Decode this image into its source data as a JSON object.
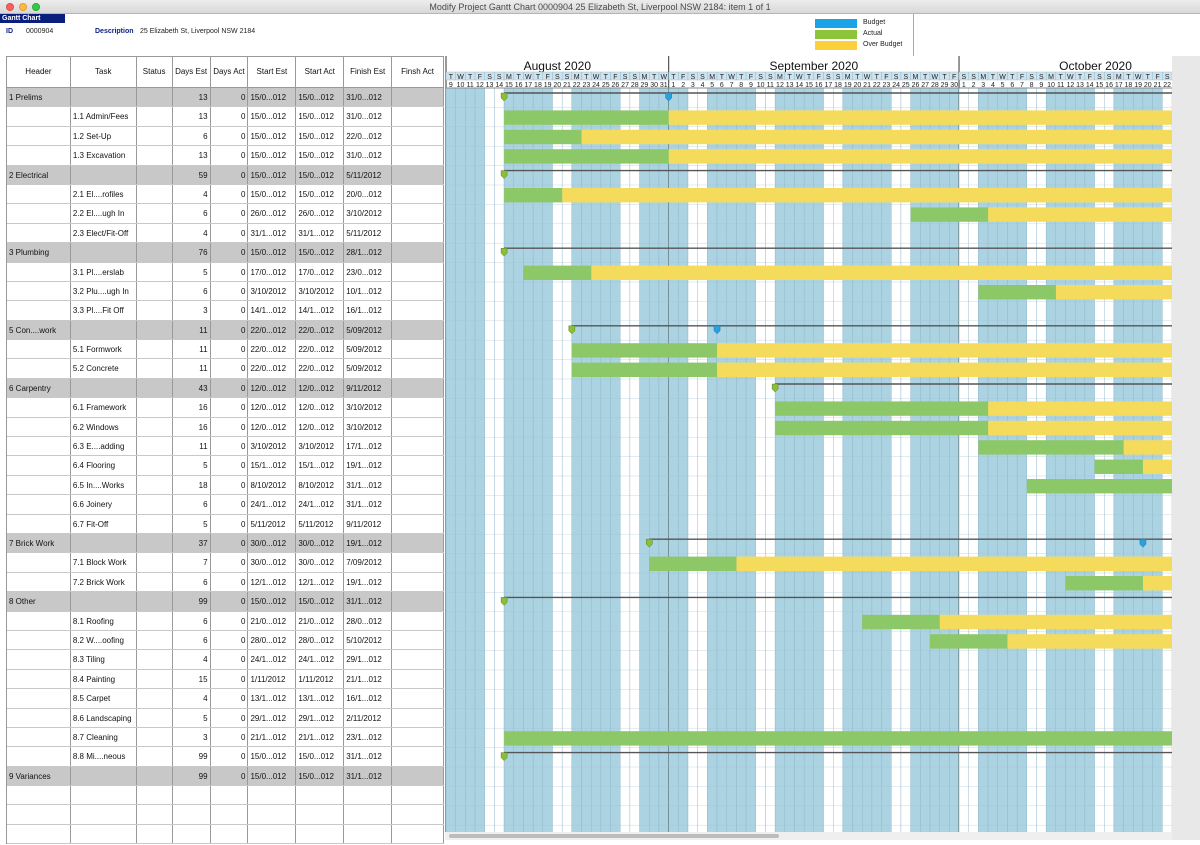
{
  "window": {
    "title": "Modify Project Gantt Chart 0000904 25 Elizabeth St, Liverpool NSW 2184: item 1  of  1"
  },
  "app_label": "Gantt Chart",
  "info": {
    "id_label": "ID",
    "id_value": "0000904",
    "desc_label": "Description",
    "desc_value": "25 Elizabeth St, Liverpool NSW 2184"
  },
  "legend": [
    {
      "label": "Budget",
      "color": "#1aa3e6"
    },
    {
      "label": "Actual",
      "color": "#8cc43a"
    },
    {
      "label": "Over Budget",
      "color": "#fbd03a"
    }
  ],
  "colors": {
    "weekday": "#acd3e2",
    "weekend": "#ffffff",
    "actual": "#8dc868",
    "over": "#f5db5c",
    "budget_marker": "#2aa0de",
    "actual_marker": "#8cbe3a",
    "group_row": "#c8c8c8"
  },
  "columns": [
    "Header",
    "Task",
    "Status",
    "Days Est",
    "Days Act",
    "Start Est",
    "Start Act",
    "Finish Est",
    "Finsh Act"
  ],
  "rows": [
    {
      "group": true,
      "header": "1 Prelims",
      "task": "",
      "days_est": "13",
      "days_act": "0",
      "start_est": "15/0...012",
      "start_act": "15/0...012",
      "finish_est": "31/0...012"
    },
    {
      "group": false,
      "header": "",
      "task": "1.1 Admin/Fees",
      "days_est": "13",
      "days_act": "0",
      "start_est": "15/0...012",
      "start_act": "15/0...012",
      "finish_est": "31/0...012"
    },
    {
      "group": false,
      "header": "",
      "task": "1.2 Set-Up",
      "days_est": "6",
      "days_act": "0",
      "start_est": "15/0...012",
      "start_act": "15/0...012",
      "finish_est": "22/0...012"
    },
    {
      "group": false,
      "header": "",
      "task": "1.3 Excavation",
      "days_est": "13",
      "days_act": "0",
      "start_est": "15/0...012",
      "start_act": "15/0...012",
      "finish_est": "31/0...012"
    },
    {
      "group": true,
      "header": "2 Electrical",
      "task": "",
      "days_est": "59",
      "days_act": "0",
      "start_est": "15/0...012",
      "start_act": "15/0...012",
      "finish_est": "5/11/2012"
    },
    {
      "group": false,
      "header": "",
      "task": "2.1 El....rofiles",
      "days_est": "4",
      "days_act": "0",
      "start_est": "15/0...012",
      "start_act": "15/0...012",
      "finish_est": "20/0...012"
    },
    {
      "group": false,
      "header": "",
      "task": "2.2 El....ugh In",
      "days_est": "6",
      "days_act": "0",
      "start_est": "26/0...012",
      "start_act": "26/0...012",
      "finish_est": "3/10/2012"
    },
    {
      "group": false,
      "header": "",
      "task": "2.3 Elect/Fit-Off",
      "days_est": "4",
      "days_act": "0",
      "start_est": "31/1...012",
      "start_act": "31/1...012",
      "finish_est": "5/11/2012"
    },
    {
      "group": true,
      "header": "3 Plumbing",
      "task": "",
      "days_est": "76",
      "days_act": "0",
      "start_est": "15/0...012",
      "start_act": "15/0...012",
      "finish_est": "28/1...012"
    },
    {
      "group": false,
      "header": "",
      "task": "3.1 Pl....erslab",
      "days_est": "5",
      "days_act": "0",
      "start_est": "17/0...012",
      "start_act": "17/0...012",
      "finish_est": "23/0...012"
    },
    {
      "group": false,
      "header": "",
      "task": "3.2 Plu....ugh In",
      "days_est": "6",
      "days_act": "0",
      "start_est": "3/10/2012",
      "start_act": "3/10/2012",
      "finish_est": "10/1...012"
    },
    {
      "group": false,
      "header": "",
      "task": "3.3 Pl....Fit Off",
      "days_est": "3",
      "days_act": "0",
      "start_est": "14/1...012",
      "start_act": "14/1...012",
      "finish_est": "16/1...012"
    },
    {
      "group": true,
      "header": "5 Con....work",
      "task": "",
      "days_est": "11",
      "days_act": "0",
      "start_est": "22/0...012",
      "start_act": "22/0...012",
      "finish_est": "5/09/2012"
    },
    {
      "group": false,
      "header": "",
      "task": "5.1 Formwork",
      "days_est": "11",
      "days_act": "0",
      "start_est": "22/0...012",
      "start_act": "22/0...012",
      "finish_est": "5/09/2012"
    },
    {
      "group": false,
      "header": "",
      "task": "5.2 Concrete",
      "days_est": "11",
      "days_act": "0",
      "start_est": "22/0...012",
      "start_act": "22/0...012",
      "finish_est": "5/09/2012"
    },
    {
      "group": true,
      "header": "6 Carpentry",
      "task": "",
      "days_est": "43",
      "days_act": "0",
      "start_est": "12/0...012",
      "start_act": "12/0...012",
      "finish_est": "9/11/2012"
    },
    {
      "group": false,
      "header": "",
      "task": "6.1 Framework",
      "days_est": "16",
      "days_act": "0",
      "start_est": "12/0...012",
      "start_act": "12/0...012",
      "finish_est": "3/10/2012"
    },
    {
      "group": false,
      "header": "",
      "task": "6.2 Windows",
      "days_est": "16",
      "days_act": "0",
      "start_est": "12/0...012",
      "start_act": "12/0...012",
      "finish_est": "3/10/2012"
    },
    {
      "group": false,
      "header": "",
      "task": "6.3 E....adding",
      "days_est": "11",
      "days_act": "0",
      "start_est": "3/10/2012",
      "start_act": "3/10/2012",
      "finish_est": "17/1...012"
    },
    {
      "group": false,
      "header": "",
      "task": "6.4 Flooring",
      "days_est": "5",
      "days_act": "0",
      "start_est": "15/1...012",
      "start_act": "15/1...012",
      "finish_est": "19/1...012"
    },
    {
      "group": false,
      "header": "",
      "task": "6.5 In....Works",
      "days_est": "18",
      "days_act": "0",
      "start_est": "8/10/2012",
      "start_act": "8/10/2012",
      "finish_est": "31/1...012"
    },
    {
      "group": false,
      "header": "",
      "task": "6.6 Joinery",
      "days_est": "6",
      "days_act": "0",
      "start_est": "24/1...012",
      "start_act": "24/1...012",
      "finish_est": "31/1...012"
    },
    {
      "group": false,
      "header": "",
      "task": "6.7 Fit-Off",
      "days_est": "5",
      "days_act": "0",
      "start_est": "5/11/2012",
      "start_act": "5/11/2012",
      "finish_est": "9/11/2012"
    },
    {
      "group": true,
      "header": "7 Brick Work",
      "task": "",
      "days_est": "37",
      "days_act": "0",
      "start_est": "30/0...012",
      "start_act": "30/0...012",
      "finish_est": "19/1...012"
    },
    {
      "group": false,
      "header": "",
      "task": "7.1 Block Work",
      "days_est": "7",
      "days_act": "0",
      "start_est": "30/0...012",
      "start_act": "30/0...012",
      "finish_est": "7/09/2012"
    },
    {
      "group": false,
      "header": "",
      "task": "7.2 Brick Work",
      "days_est": "6",
      "days_act": "0",
      "start_est": "12/1...012",
      "start_act": "12/1...012",
      "finish_est": "19/1...012"
    },
    {
      "group": true,
      "header": "8 Other",
      "task": "",
      "days_est": "99",
      "days_act": "0",
      "start_est": "15/0...012",
      "start_act": "15/0...012",
      "finish_est": "31/1...012"
    },
    {
      "group": false,
      "header": "",
      "task": "8.1 Roofing",
      "days_est": "6",
      "days_act": "0",
      "start_est": "21/0...012",
      "start_act": "21/0...012",
      "finish_est": "28/0...012"
    },
    {
      "group": false,
      "header": "",
      "task": "8.2 W....oofing",
      "days_est": "6",
      "days_act": "0",
      "start_est": "28/0...012",
      "start_act": "28/0...012",
      "finish_est": "5/10/2012"
    },
    {
      "group": false,
      "header": "",
      "task": "8.3 Tiling",
      "days_est": "4",
      "days_act": "0",
      "start_est": "24/1...012",
      "start_act": "24/1...012",
      "finish_est": "29/1...012"
    },
    {
      "group": false,
      "header": "",
      "task": "8.4 Painting",
      "days_est": "15",
      "days_act": "0",
      "start_est": "1/11/2012",
      "start_act": "1/11/2012",
      "finish_est": "21/1...012"
    },
    {
      "group": false,
      "header": "",
      "task": "8.5 Carpet",
      "days_est": "4",
      "days_act": "0",
      "start_est": "13/1...012",
      "start_act": "13/1...012",
      "finish_est": "16/1...012"
    },
    {
      "group": false,
      "header": "",
      "task": "8.6 Landscaping",
      "days_est": "5",
      "days_act": "0",
      "start_est": "29/1...012",
      "start_act": "29/1...012",
      "finish_est": "2/11/2012"
    },
    {
      "group": false,
      "header": "",
      "task": "8.7 Cleaning",
      "days_est": "3",
      "days_act": "0",
      "start_est": "21/1...012",
      "start_act": "21/1...012",
      "finish_est": "23/1...012"
    },
    {
      "group": false,
      "header": "",
      "task": "8.8 Mi....neous",
      "days_est": "99",
      "days_act": "0",
      "start_est": "15/0...012",
      "start_act": "15/0...012",
      "finish_est": "31/1...012"
    },
    {
      "group": true,
      "header": "9 Variances",
      "task": "",
      "days_est": "99",
      "days_act": "0",
      "start_est": "15/0...012",
      "start_act": "15/0...012",
      "finish_est": "31/1...012"
    }
  ],
  "empty_rows": 3,
  "timeline": {
    "months": [
      {
        "label": "August 2020",
        "days": 23
      },
      {
        "label": "September 2020",
        "days": 30
      },
      {
        "label": "October 2020",
        "days": 22
      }
    ],
    "first_day": 9,
    "first_weekday": "T",
    "weekday_letters": [
      "M",
      "T",
      "W",
      "T",
      "F",
      "S",
      "S"
    ]
  },
  "gantt": {
    "bars": [
      {
        "row": 1,
        "actual": [
          6,
          23
        ],
        "over_end": 75
      },
      {
        "row": 2,
        "actual": [
          6,
          14
        ],
        "over_end": 75
      },
      {
        "row": 3,
        "actual": [
          6,
          23
        ],
        "over_end": 75
      },
      {
        "row": 5,
        "actual": [
          6,
          12
        ],
        "over_end": 75
      },
      {
        "row": 6,
        "actual": [
          48,
          56
        ],
        "over_end": 75
      },
      {
        "row": 9,
        "actual": [
          8,
          15
        ],
        "over_end": 75
      },
      {
        "row": 10,
        "actual": [
          55,
          63
        ],
        "over_end": 75
      },
      {
        "row": 13,
        "actual": [
          13,
          28
        ],
        "over_end": 75
      },
      {
        "row": 14,
        "actual": [
          13,
          28
        ],
        "over_end": 75
      },
      {
        "row": 16,
        "actual": [
          34,
          56
        ],
        "over_end": 75
      },
      {
        "row": 17,
        "actual": [
          34,
          56
        ],
        "over_end": 75
      },
      {
        "row": 18,
        "actual": [
          55,
          70
        ],
        "over_end": 75
      },
      {
        "row": 19,
        "actual": [
          67,
          72
        ],
        "over_end": 75
      },
      {
        "row": 20,
        "actual": [
          60,
          75
        ],
        "over_end": 75
      },
      {
        "row": 21,
        "actual": [
          75,
          75
        ],
        "over_end": 75
      },
      {
        "row": 24,
        "actual": [
          21,
          30
        ],
        "over_end": 75
      },
      {
        "row": 25,
        "actual": [
          64,
          72
        ],
        "over_end": 75
      },
      {
        "row": 27,
        "actual": [
          43,
          51
        ],
        "over_end": 75
      },
      {
        "row": 28,
        "actual": [
          50,
          58
        ],
        "over_end": 75
      },
      {
        "row": 33,
        "actual": [
          6,
          75
        ],
        "over_end": 75
      }
    ],
    "group_lines": [
      {
        "row": 0,
        "actual_marker": 6,
        "budget_marker": 23
      },
      {
        "row": 4,
        "actual_marker": 6,
        "budget_marker": null
      },
      {
        "row": 8,
        "actual_marker": 6,
        "budget_marker": null
      },
      {
        "row": 12,
        "actual_marker": 13,
        "budget_marker": 28
      },
      {
        "row": 15,
        "actual_marker": 34,
        "budget_marker": null
      },
      {
        "row": 23,
        "actual_marker": 21,
        "budget_marker": 72
      },
      {
        "row": 26,
        "actual_marker": 6,
        "budget_marker": null
      },
      {
        "row": 34,
        "actual_marker": 6,
        "budget_marker": null
      }
    ]
  }
}
